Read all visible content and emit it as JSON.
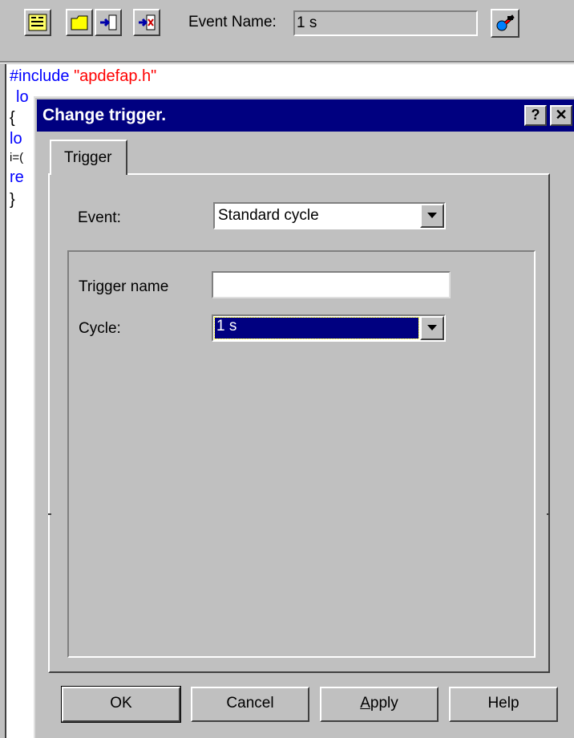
{
  "toolbar": {
    "buttons": [
      {
        "icon": "declarations-icon"
      },
      {
        "icon": "folder-icon"
      },
      {
        "icon": "import-icon"
      },
      {
        "icon": "export-icon"
      }
    ],
    "event_label": "Event Name:",
    "event_value": "1 s",
    "change_trigger_icon": "change-trigger-icon"
  },
  "editor": {
    "line1_directive": "#include",
    "line1_file": "\"apdefap.h\"",
    "line2": "lo",
    "line3": "{",
    "line4": "lo",
    "line5": "i=(",
    "line6": "re",
    "line7": "}"
  },
  "dialog": {
    "title": "Change trigger.",
    "help_button": "?",
    "close_button": "✕",
    "tab_label": "Trigger",
    "event_label": "Event:",
    "event_value": "Standard cycle",
    "trigger_name_label": "Trigger name",
    "trigger_name_value": "",
    "cycle_label": "Cycle:",
    "cycle_value": "1 s",
    "buttons": {
      "ok": "OK",
      "cancel": "Cancel",
      "apply_prefix": "A",
      "apply_rest": "pply",
      "help": "Help"
    }
  },
  "colors": {
    "titlebar": "#000080",
    "keyword": "#0000ff",
    "string": "#ff0000",
    "face": "#c0c0c0"
  }
}
